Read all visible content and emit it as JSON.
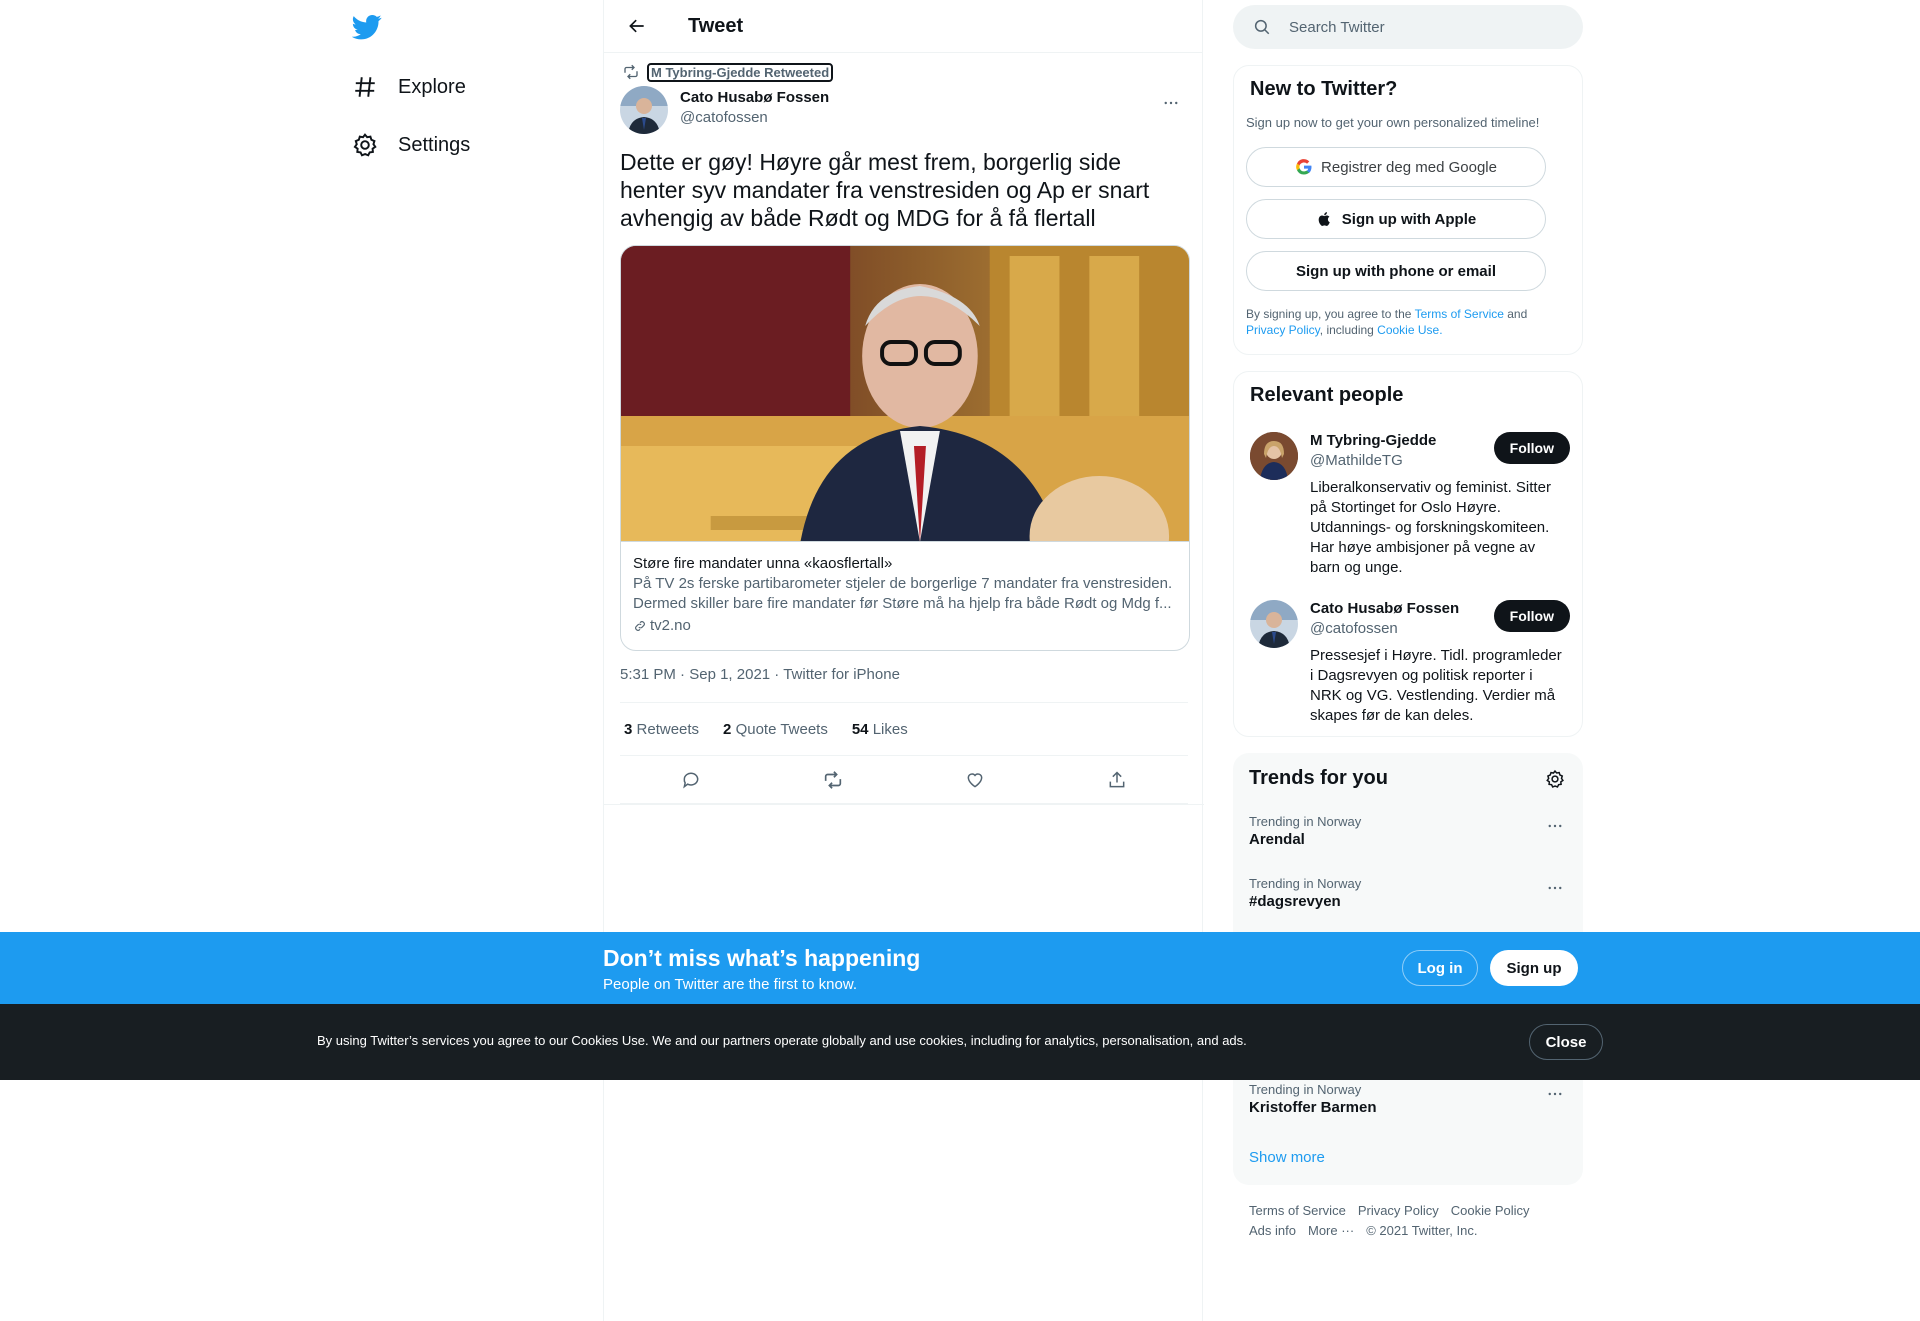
{
  "nav": {
    "items": [
      {
        "label": "Explore",
        "icon": "hashtag-icon"
      },
      {
        "label": "Settings",
        "icon": "gear-icon"
      }
    ]
  },
  "header": {
    "title": "Tweet"
  },
  "tweet": {
    "retweeted_by": "M Tybring-Gjedde Retweeted",
    "author_name": "Cato Husabø Fossen",
    "author_handle": "@catofossen",
    "text": "Dette er gøy! Høyre går mest frem, borgerlig side henter syv mandater fra venstresiden og Ap er snart avhengig av både Rødt og MDG for å få flertall",
    "card": {
      "title": "Støre fire mandater unna «kaosflertall»",
      "description": "På TV 2s ferske partibarometer stjeler de borgerlige 7 mandater fra venstresiden. Dermed skiller bare fire mandater før Støre må ha hjelp fra både Rødt og Mdg f...",
      "domain": "tv2.no"
    },
    "time": "5:31 PM",
    "date": "Sep 1, 2021",
    "source": "Twitter for iPhone",
    "stats": {
      "retweets_count": "3",
      "retweets_label": "Retweets",
      "quotes_count": "2",
      "quotes_label": "Quote Tweets",
      "likes_count": "54",
      "likes_label": "Likes"
    }
  },
  "search": {
    "placeholder": "Search Twitter"
  },
  "new_to_twitter": {
    "title": "New to Twitter?",
    "subtitle": "Sign up now to get your own personalized timeline!",
    "google_label": "Registrer deg med Google",
    "apple_label": "Sign up with Apple",
    "phone_label": "Sign up with phone or email",
    "terms_prefix": "By signing up, you agree to the ",
    "terms_link": "Terms of Service",
    "terms_and": " and ",
    "privacy_link": "Privacy Policy",
    "terms_including": ", including ",
    "cookie_link": "Cookie Use."
  },
  "relevant_people": {
    "title": "Relevant people",
    "people": [
      {
        "name": "M Tybring-Gjedde",
        "handle": "@MathildeTG",
        "bio": "Liberalkonservativ og feminist. Sitter på Stortinget for Oslo Høyre. Utdannings- og forskningskomiteen. Har høye ambisjoner på vegne av barn og unge.",
        "follow_label": "Follow"
      },
      {
        "name": "Cato Husabø Fossen",
        "handle": "@catofossen",
        "bio": "Pressesjef i Høyre. Tidl. programleder i Dagsrevyen og politisk reporter i NRK og VG. Vestlending. Verdier må skapes før de kan deles.",
        "follow_label": "Follow"
      }
    ]
  },
  "trends": {
    "title": "Trends for you",
    "items": [
      {
        "context": "Trending in Norway",
        "name": "Arendal"
      },
      {
        "context": "Trending in Norway",
        "name": "#dagsrevyen"
      },
      {
        "context": "Trending in Norway",
        "name": "Kristoffer Barmen"
      }
    ],
    "show_more": "Show more"
  },
  "footer": {
    "links": [
      "Terms of Service",
      "Privacy Policy",
      "Cookie Policy",
      "Ads info",
      "More ···"
    ],
    "copyright": "© 2021 Twitter, Inc."
  },
  "signup_banner": {
    "title": "Don’t miss what’s happening",
    "subtitle": "People on Twitter are the first to know.",
    "login_label": "Log in",
    "signup_label": "Sign up"
  },
  "cookie_banner": {
    "text": "By using Twitter’s services you agree to our Cookies Use. We and our partners operate globally and use cookies, including for analytics, personalisation, and ads.",
    "close_label": "Close"
  },
  "colors": {
    "accent": "#1d9bf0",
    "text": "#0f1419",
    "secondary": "#536471",
    "cookie_bg": "#181e22"
  }
}
